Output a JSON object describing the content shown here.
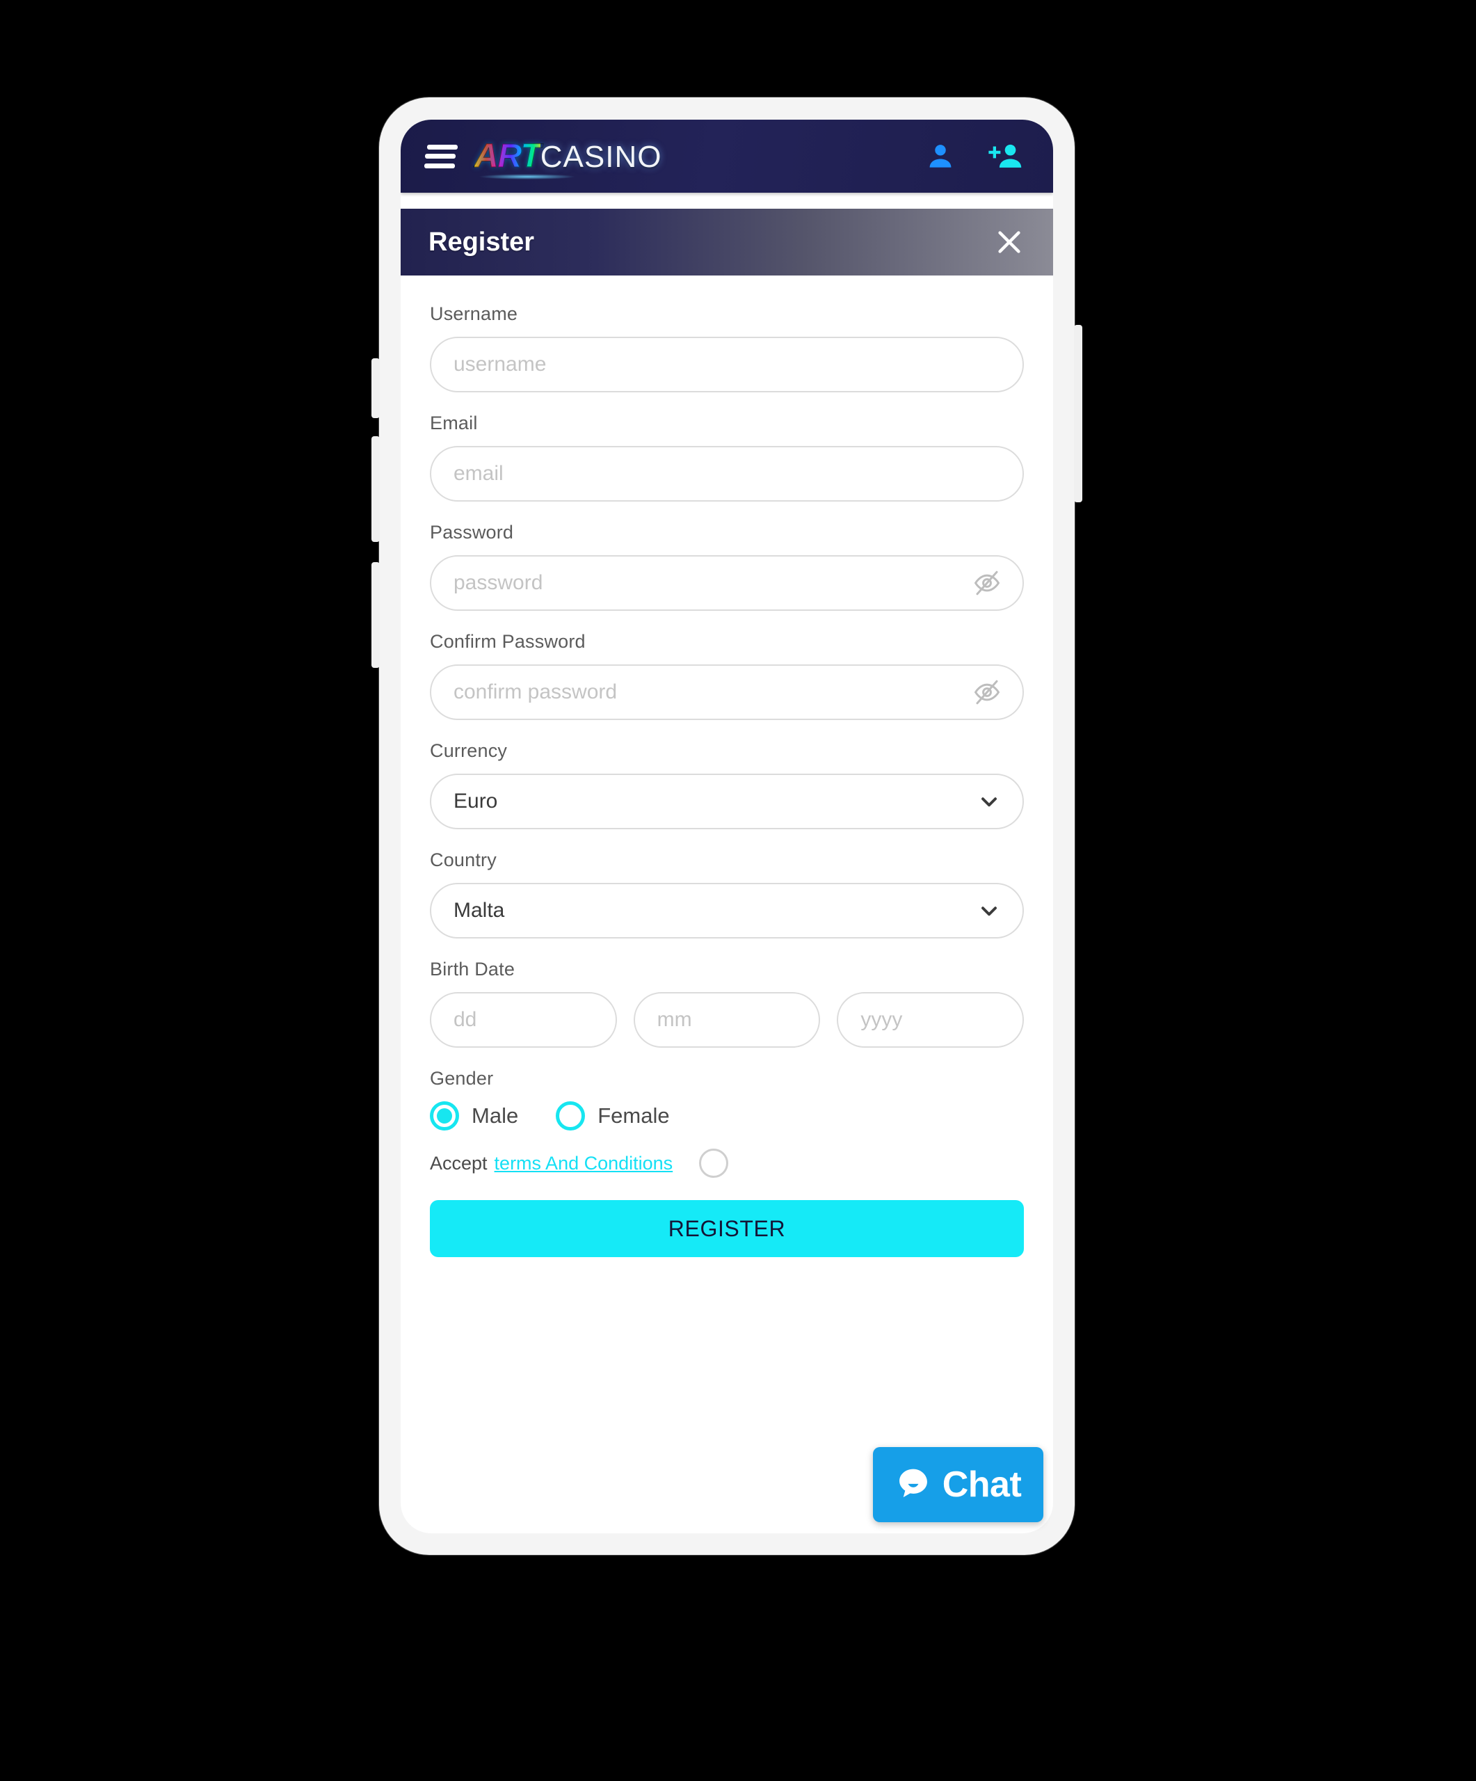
{
  "site": {
    "navbar": {
      "menu_icon": "hamburger-menu-icon",
      "logo_primary": "ART",
      "logo_secondary": "CASINO",
      "profile_icon": "person-icon",
      "register_icon": "person-add-icon"
    }
  },
  "modal": {
    "title": "Register",
    "close_icon": "close-x-icon"
  },
  "form": {
    "username": {
      "label": "Username",
      "placeholder": "username",
      "value": ""
    },
    "email": {
      "label": "Email",
      "placeholder": "email",
      "value": ""
    },
    "password": {
      "label": "Password",
      "placeholder": "password",
      "value": "",
      "toggle_icon": "eye-off-icon"
    },
    "confirm_password": {
      "label": "Confirm Password",
      "placeholder": "confirm password",
      "value": "",
      "toggle_icon": "eye-off-icon"
    },
    "currency": {
      "label": "Currency",
      "value": "Euro",
      "chevron_icon": "chevron-down-icon"
    },
    "country": {
      "label": "Country",
      "value": "Malta",
      "chevron_icon": "chevron-down-icon"
    },
    "birth_date": {
      "label": "Birth Date",
      "day_placeholder": "dd",
      "day_value": "",
      "month_placeholder": "mm",
      "month_value": "",
      "year_placeholder": "yyyy",
      "year_value": ""
    },
    "gender": {
      "label": "Gender",
      "male_label": "Male",
      "female_label": "Female",
      "selected": "Male"
    },
    "terms": {
      "prefix": "Accept",
      "link_text": "terms And Conditions",
      "checked": false
    },
    "submit_label": "REGISTER"
  },
  "chat": {
    "label": "Chat",
    "icon": "chat-bubble-icon"
  },
  "colors": {
    "brand_navy": "#22224f",
    "accent_cyan": "#15eaf7",
    "chat_blue": "#169fe8",
    "profile_blue": "#1e90ff"
  }
}
